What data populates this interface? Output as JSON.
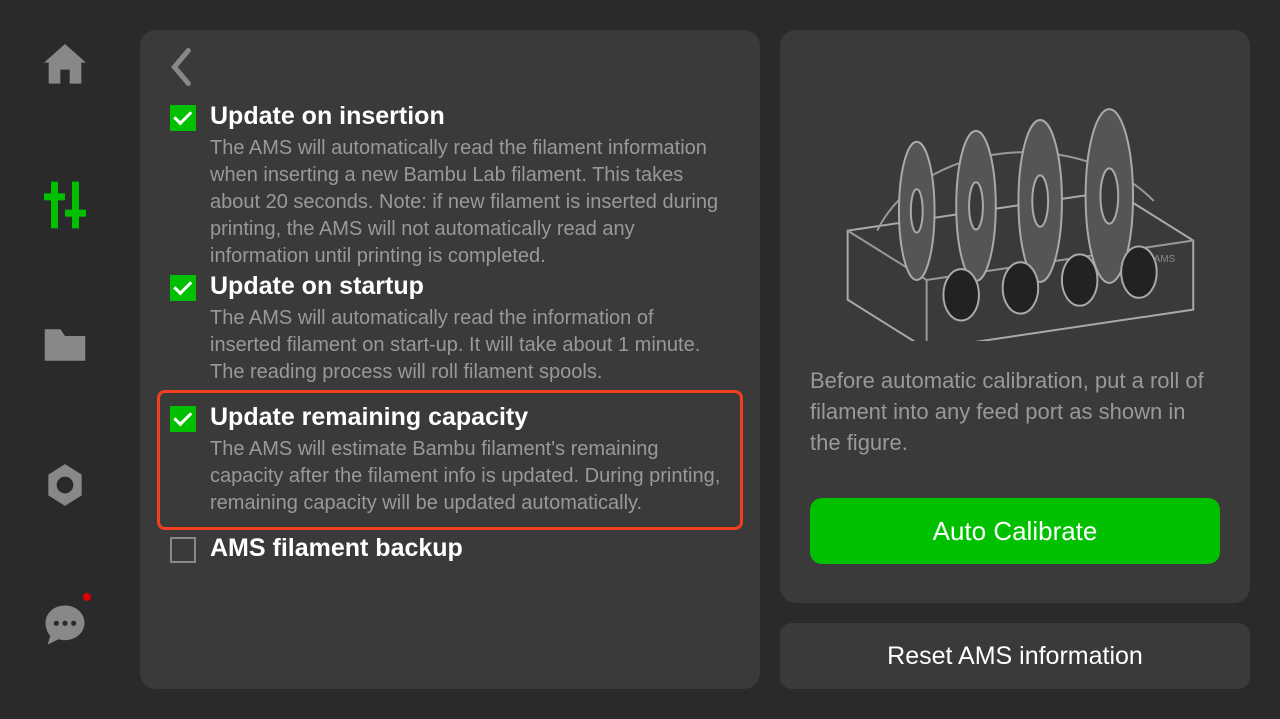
{
  "options": [
    {
      "checked": true,
      "title": "Update on insertion",
      "desc": "The AMS will automatically read the filament information when inserting a new Bambu Lab filament. This takes about 20 seconds.\nNote: if new filament is inserted during  printing, the AMS will not automatically read any information until printing is completed."
    },
    {
      "checked": true,
      "title": "Update on startup",
      "desc": "The AMS will automatically read the information of inserted filament on start-up. It will take about 1 minute.\nThe reading process will roll filament spools."
    },
    {
      "checked": true,
      "highlighted": true,
      "title": "Update remaining capacity",
      "desc": "The AMS will estimate Bambu filament's remaining capacity after the filament info is updated. During printing, remaining capacity will be updated automatically."
    },
    {
      "checked": false,
      "title": "AMS filament backup",
      "desc": ""
    }
  ],
  "right": {
    "calib_text": "Before automatic calibration, put a roll of filament into any feed port as shown in the figure.",
    "calib_button": "Auto Calibrate",
    "reset_button": "Reset AMS information"
  }
}
